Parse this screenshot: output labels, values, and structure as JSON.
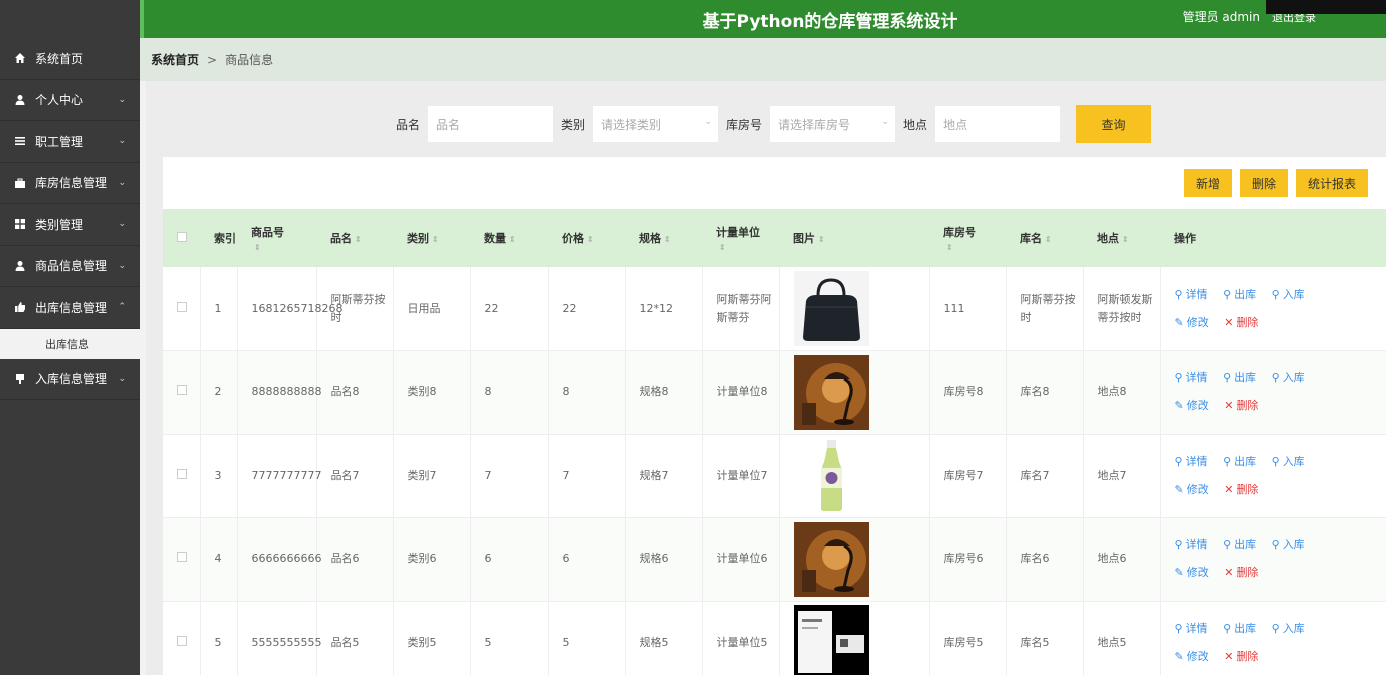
{
  "header": {
    "title": "基于Python的仓库管理系统设计",
    "user": "管理员 admin",
    "logout": "退出登录"
  },
  "sidebar": {
    "items": [
      {
        "label": "系统首页",
        "icon": "home-icon",
        "arrow": ""
      },
      {
        "label": "个人中心",
        "icon": "user-icon",
        "arrow": "⌄"
      },
      {
        "label": "职工管理",
        "icon": "list-icon",
        "arrow": "⌄"
      },
      {
        "label": "库房信息管理",
        "icon": "briefcase-icon",
        "arrow": "⌄"
      },
      {
        "label": "类别管理",
        "icon": "grid-icon",
        "arrow": "⌄"
      },
      {
        "label": "商品信息管理",
        "icon": "user-icon",
        "arrow": "⌄"
      },
      {
        "label": "出库信息管理",
        "icon": "thumb-icon",
        "arrow": "⌃"
      }
    ],
    "sub_item": "出库信息",
    "last_item": {
      "label": "入库信息管理",
      "icon": "tag-icon",
      "arrow": "⌄"
    }
  },
  "breadcrumb": {
    "home": "系统首页",
    "sep": ">",
    "current": "商品信息"
  },
  "search": {
    "name_label": "品名",
    "name_placeholder": "品名",
    "category_label": "类别",
    "category_placeholder": "请选择类别",
    "room_label": "库房号",
    "room_placeholder": "请选择库房号",
    "location_label": "地点",
    "location_placeholder": "地点",
    "button": "查询"
  },
  "actions": {
    "add": "新增",
    "delete": "删除",
    "report": "统计报表"
  },
  "table": {
    "headers": {
      "index": "索引",
      "code": "商品号",
      "name": "品名",
      "category": "类别",
      "qty": "数量",
      "price": "价格",
      "spec": "规格",
      "unit": "计量单位",
      "image": "图片",
      "room": "库房号",
      "room_name": "库名",
      "location": "地点",
      "ops": "操作"
    },
    "op_labels": {
      "detail": "详情",
      "out": "出库",
      "in": "入库",
      "edit": "修改",
      "del": "删除"
    },
    "rows": [
      {
        "index": "1",
        "code": "1681265718268",
        "name": "阿斯蒂芬按时",
        "category": "日用品",
        "qty": "22",
        "price": "22",
        "spec": "12*12",
        "unit": "阿斯蒂芬阿斯蒂芬",
        "img": "handbag",
        "room": "111",
        "room_name": "阿斯蒂芬按时",
        "location": "阿斯顿发斯蒂芬按时"
      },
      {
        "index": "2",
        "code": "8888888888",
        "name": "品名8",
        "category": "类别8",
        "qty": "8",
        "price": "8",
        "spec": "规格8",
        "unit": "计量单位8",
        "img": "lamp",
        "room": "库房号8",
        "room_name": "库名8",
        "location": "地点8"
      },
      {
        "index": "3",
        "code": "7777777777",
        "name": "品名7",
        "category": "类别7",
        "qty": "7",
        "price": "7",
        "spec": "规格7",
        "unit": "计量单位7",
        "img": "bottle",
        "room": "库房号7",
        "room_name": "库名7",
        "location": "地点7"
      },
      {
        "index": "4",
        "code": "6666666666",
        "name": "品名6",
        "category": "类别6",
        "qty": "6",
        "price": "6",
        "spec": "规格6",
        "unit": "计量单位6",
        "img": "lamp",
        "room": "库房号6",
        "room_name": "库名6",
        "location": "地点6"
      },
      {
        "index": "5",
        "code": "5555555555",
        "name": "品名5",
        "category": "类别5",
        "qty": "5",
        "price": "5",
        "spec": "规格5",
        "unit": "计量单位5",
        "img": "book",
        "room": "库房号5",
        "room_name": "库名5",
        "location": "地点5"
      }
    ]
  },
  "colors": {
    "header_green": "#2e8b2e",
    "sidebar_dark": "#3a3a3a",
    "accent_yellow": "#f7c21f",
    "table_head": "#d9efd6",
    "link_blue": "#3a8ee6",
    "danger_red": "#e43c3c"
  }
}
